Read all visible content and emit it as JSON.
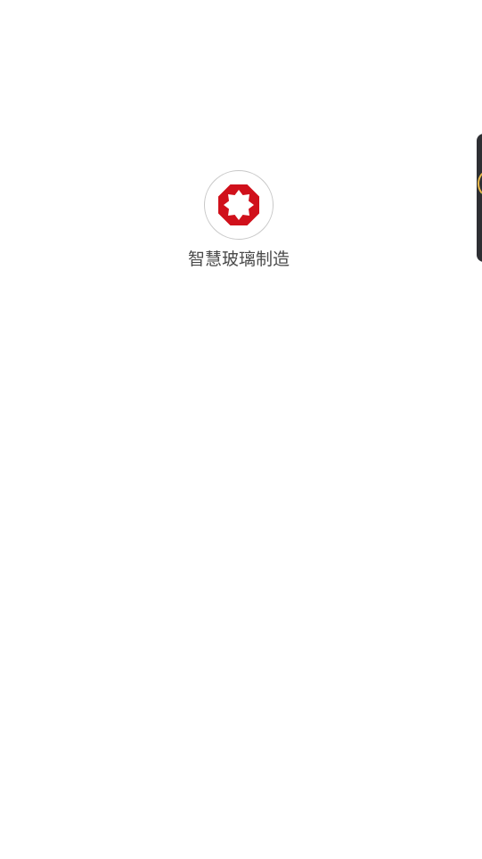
{
  "app": {
    "label": "智慧玻璃制造",
    "icon": "octagon-star-logo-icon",
    "icon_color": "#d0101b"
  },
  "floating_panel": {
    "icon": "assistive-ball-icon",
    "background_color": "#2e2f33"
  }
}
